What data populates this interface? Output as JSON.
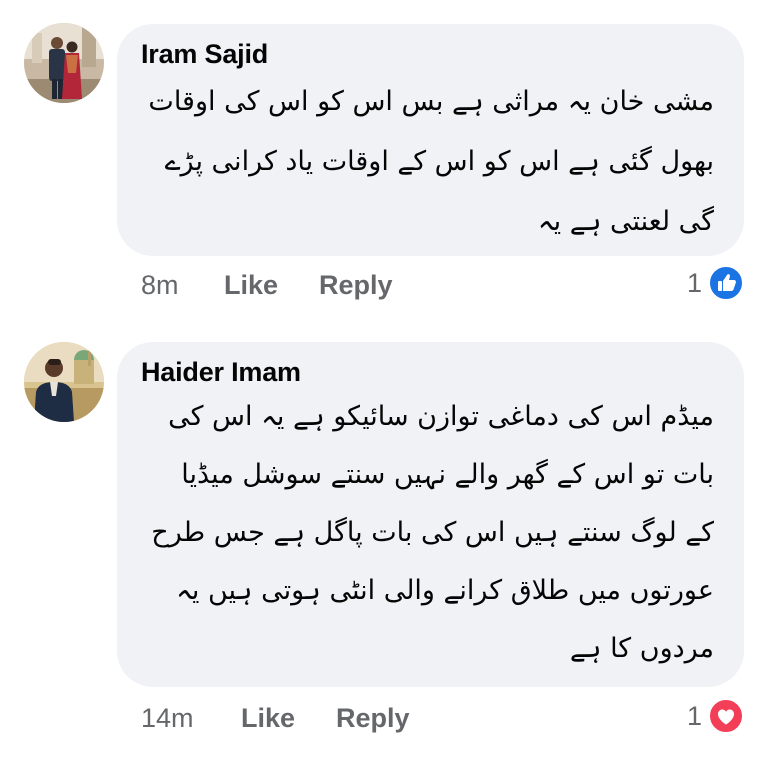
{
  "comments": [
    {
      "author": "Iram Sajid",
      "text": "مشی خان یہ مراثی ہے بس اس کو اس کی اوقات\nبھول گئی ہے اس کو اس کے اوقات یاد کرانی پڑے\nگی لعنتی ہے یہ",
      "time": "8m",
      "like_label": "Like",
      "reply_label": "Reply",
      "reaction_count": "1",
      "reaction_icon": "like-icon",
      "reaction_color": "#1b74e4"
    },
    {
      "author": "Haider Imam",
      "text": "میڈم اس کی دماغی توازن سائیکو ہے یہ اس کی\nبات تو اس کے گھر والے نہیں سنتے سوشل میڈیا\nکے لوگ سنتے ہیں اس کی بات پاگل ہے جس طرح\nعورتوں میں طلاق کرانے والی انٹی ہوتی ہیں یہ\nمردوں کا ہے",
      "time": "14m",
      "like_label": "Like",
      "reply_label": "Reply",
      "reaction_count": "1",
      "reaction_icon": "love-icon",
      "reaction_color": "#f33e58"
    }
  ]
}
